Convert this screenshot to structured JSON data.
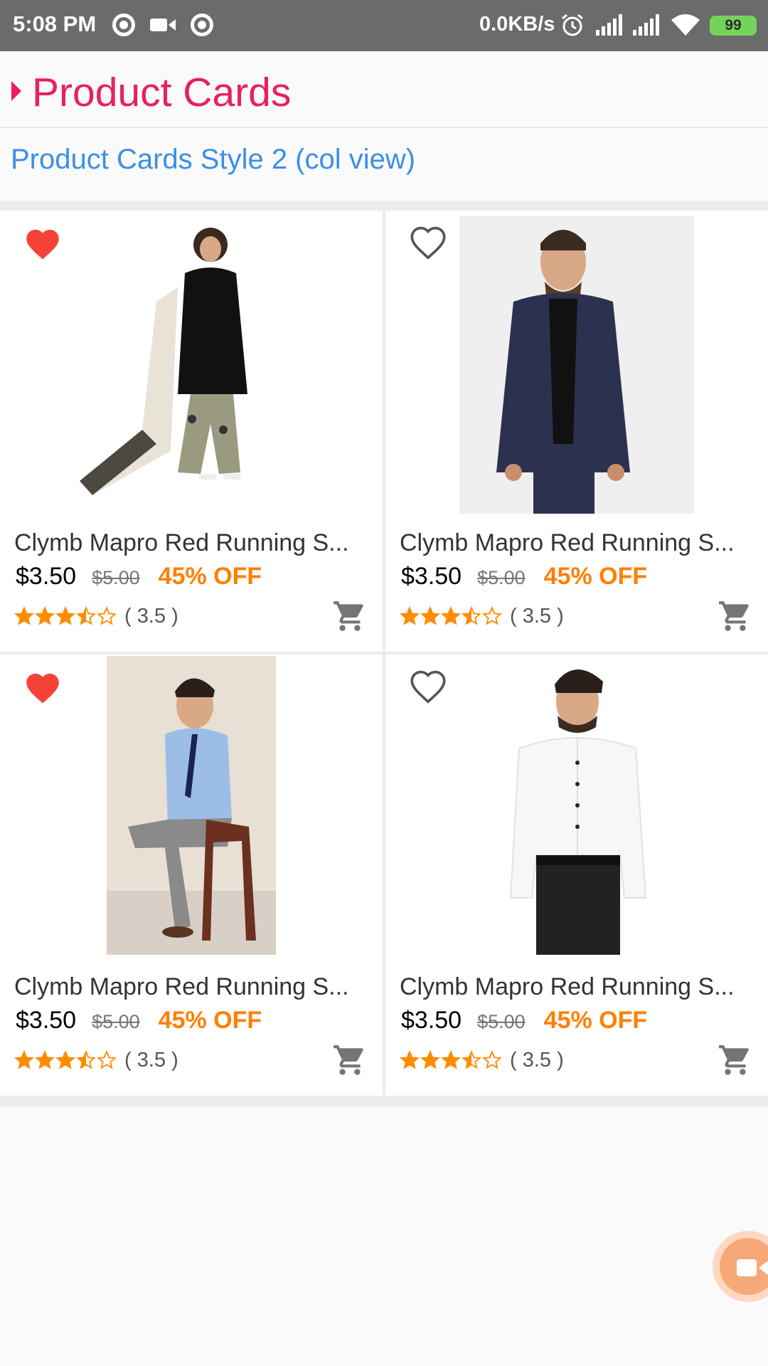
{
  "status_bar": {
    "time": "5:08 PM",
    "network_speed": "0.0KB/s",
    "battery": "99",
    "icons": [
      "record-icon",
      "video-camera-icon",
      "record-icon",
      "alarm-icon",
      "signal-icon",
      "signal-icon",
      "wifi-icon",
      "battery-icon"
    ]
  },
  "header": {
    "title": "Product Cards",
    "subtitle": "Product Cards Style 2 (col view)"
  },
  "colors": {
    "title": "#e91e63",
    "subtitle": "#3d8ee6",
    "favorite": "#f44336",
    "discount": "#ff7f00",
    "star": "#ff8c00",
    "icon_gray": "#757575"
  },
  "products": [
    {
      "name": "Clymb Mapro Red Running S...",
      "price": "$3.50",
      "old_price": "$5.00",
      "discount": "45% OFF",
      "rating": 3.5,
      "rating_text": "( 3.5 )",
      "favorited": true,
      "image": "woman-black-kurta-photo"
    },
    {
      "name": "Clymb Mapro Red Running S...",
      "price": "$3.50",
      "old_price": "$5.00",
      "discount": "45% OFF",
      "rating": 3.5,
      "rating_text": "( 3.5 )",
      "favorited": false,
      "image": "man-navy-blazer-photo"
    },
    {
      "name": "Clymb Mapro Red Running S...",
      "price": "$3.50",
      "old_price": "$5.00",
      "discount": "45% OFF",
      "rating": 3.5,
      "rating_text": "( 3.5 )",
      "favorited": true,
      "image": "man-blue-shirt-chair-photo"
    },
    {
      "name": "Clymb Mapro Red Running S...",
      "price": "$3.50",
      "old_price": "$5.00",
      "discount": "45% OFF",
      "rating": 3.5,
      "rating_text": "( 3.5 )",
      "favorited": false,
      "image": "man-white-shirt-photo"
    }
  ],
  "fab": {
    "icon": "video-camera-icon"
  }
}
